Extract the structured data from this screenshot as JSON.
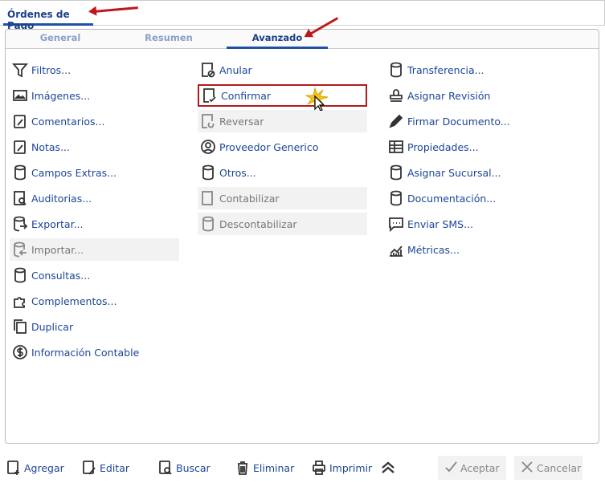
{
  "window_tab": "Órdenes de Pago",
  "tabs": [
    "General",
    "Resumen",
    "Avanzado"
  ],
  "active_tab": "Avanzado",
  "columns": [
    [
      {
        "label": "Filtros...",
        "icon": "filter-icon"
      },
      {
        "label": "Imágenes...",
        "icon": "image-icon"
      },
      {
        "label": "Comentarios...",
        "icon": "clipboard-edit-icon"
      },
      {
        "label": "Notas...",
        "icon": "clipboard-edit-icon"
      },
      {
        "label": "Campos Extras...",
        "icon": "database-icon"
      },
      {
        "label": "Auditorias...",
        "icon": "audit-search-icon"
      },
      {
        "label": "Exportar...",
        "icon": "database-export-icon"
      },
      {
        "label": "Importar...",
        "icon": "database-import-icon",
        "disabled": true
      },
      {
        "label": "Consultas...",
        "icon": "database-icon"
      },
      {
        "label": "Complementos...",
        "icon": "puzzle-icon"
      },
      {
        "label": "Duplicar",
        "icon": "copy-icon"
      },
      {
        "label": "Información Contable",
        "icon": "dollar-circle-icon"
      }
    ],
    [
      {
        "label": "Anular",
        "icon": "document-cancel-icon"
      },
      {
        "label": "Confirmar",
        "icon": "document-check-icon",
        "highlight": true
      },
      {
        "label": "Reversar",
        "icon": "document-undo-icon",
        "disabled": true
      },
      {
        "label": "Proveedor Generico",
        "icon": "user-circle-icon"
      },
      {
        "label": "Otros...",
        "icon": "database-icon"
      },
      {
        "label": "Contabilizar",
        "icon": "document-icon",
        "disabled": true
      },
      {
        "label": "Descontabilizar",
        "icon": "database-icon",
        "disabled": true
      }
    ],
    [
      {
        "label": "Transferencia...",
        "icon": "database-icon"
      },
      {
        "label": "Asignar Revisión",
        "icon": "stamp-icon"
      },
      {
        "label": "Firmar Documento...",
        "icon": "pen-icon"
      },
      {
        "label": "Propiedades...",
        "icon": "properties-grid-icon"
      },
      {
        "label": "Asignar Sucursal...",
        "icon": "database-icon"
      },
      {
        "label": "Documentación...",
        "icon": "database-icon"
      },
      {
        "label": "Enviar SMS...",
        "icon": "chat-icon"
      },
      {
        "label": "Métricas...",
        "icon": "chart-icon"
      }
    ]
  ],
  "toolbar": {
    "add": "Agregar",
    "edit": "Editar",
    "search": "Buscar",
    "delete": "Eliminar",
    "print": "Imprimir",
    "accept": "Aceptar",
    "cancel": "Cancelar"
  },
  "colors": {
    "text": "#1c4596",
    "accent": "#1f4fa8",
    "highlight": "#b31b1b"
  }
}
